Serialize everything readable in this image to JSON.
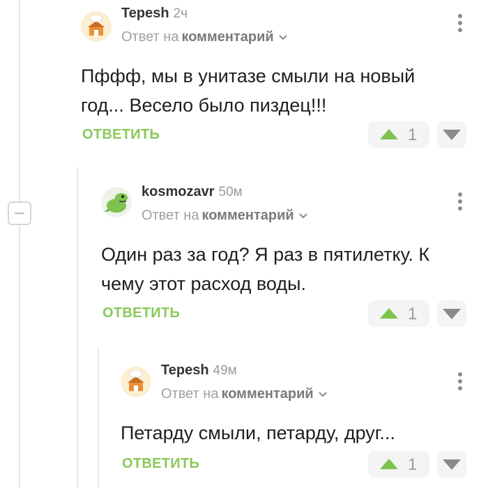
{
  "comments": [
    {
      "author": "Tepesh",
      "time": "2ч",
      "reply_prefix": "Ответ на",
      "reply_target": "комментарий",
      "text_lines": [
        "Пффф, мы в унитазе смыли на новый",
        "год... Весело было пиздец!!!"
      ],
      "reply_label": "ОТВЕТИТЬ",
      "votes": "1",
      "avatar": "chef-house-avatar"
    },
    {
      "author": "kosmozavr",
      "time": "50м",
      "reply_prefix": "Ответ на",
      "reply_target": "комментарий",
      "text_lines": [
        "Один раз за год? Я раз в пятилетку. К",
        "чему этот расход воды."
      ],
      "reply_label": "ОТВЕТИТЬ",
      "votes": "1",
      "avatar": "green-dinosaur-avatar"
    },
    {
      "author": "Tepesh",
      "time": "49м",
      "reply_prefix": "Ответ на",
      "reply_target": "комментарий",
      "text_lines": [
        "Петарду смыли, петарду, друг..."
      ],
      "reply_label": "ОТВЕТИТЬ",
      "votes": "1",
      "avatar": "chef-house-avatar"
    }
  ],
  "icons": {
    "collapse": "minus-icon",
    "menu": "kebab-menu-icon",
    "expand": "chevron-down-icon",
    "upvote": "arrow-up-icon",
    "downvote": "arrow-down-icon"
  },
  "colors": {
    "accent_green": "#7ec34e",
    "reply_green": "#8ac858",
    "muted_text": "#9a9a9a",
    "thread_line": "#e6e6e6",
    "vote_bg": "#f4f4f4"
  }
}
